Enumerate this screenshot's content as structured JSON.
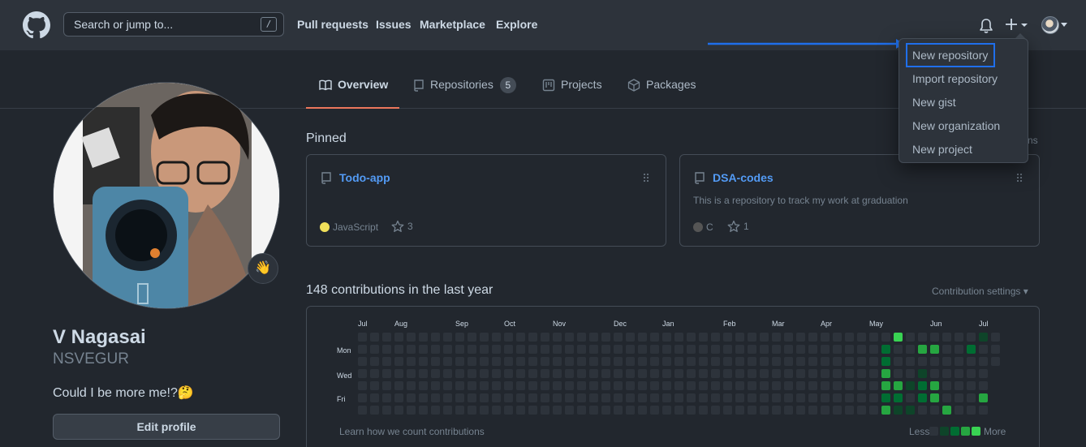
{
  "header": {
    "search_placeholder": "Search or jump to...",
    "search_key": "/",
    "nav": [
      "Pull requests",
      "Issues",
      "Marketplace",
      "Explore"
    ]
  },
  "tabs": {
    "overview": "Overview",
    "repositories": "Repositories",
    "repositories_count": "5",
    "projects": "Projects",
    "packages": "Packages"
  },
  "profile": {
    "name": "V Nagasai",
    "login": "NSVEGUR",
    "bio": "Could I be more me!?🤔",
    "status_emoji": "👋",
    "edit_label": "Edit profile"
  },
  "pinned": {
    "title": "Pinned",
    "customize_fragment": "ns",
    "cards": [
      {
        "name": "Todo-app",
        "description": "",
        "language": "JavaScript",
        "language_color": "#f1e05a",
        "stars": "3"
      },
      {
        "name": "DSA-codes",
        "description": "This is a repository to track my work at graduation",
        "language": "C",
        "language_color": "#555555",
        "stars": "1"
      }
    ]
  },
  "contributions": {
    "title": "148 contributions in the last year",
    "settings": "Contribution settings ▾",
    "months": [
      "Jul",
      "Aug",
      "Sep",
      "Oct",
      "Nov",
      "Dec",
      "Jan",
      "Feb",
      "Mar",
      "Apr",
      "May",
      "Jun",
      "Jul"
    ],
    "days": [
      "Mon",
      "Wed",
      "Fri"
    ],
    "learn": "Learn how we count contributions",
    "legend_less": "Less",
    "legend_more": "More",
    "colors": [
      "#2d333b",
      "#0e4429",
      "#006d32",
      "#26a641",
      "#39d353"
    ]
  },
  "dropdown": {
    "items": [
      "New repository",
      "Import repository",
      "New gist",
      "New organization",
      "New project"
    ]
  }
}
